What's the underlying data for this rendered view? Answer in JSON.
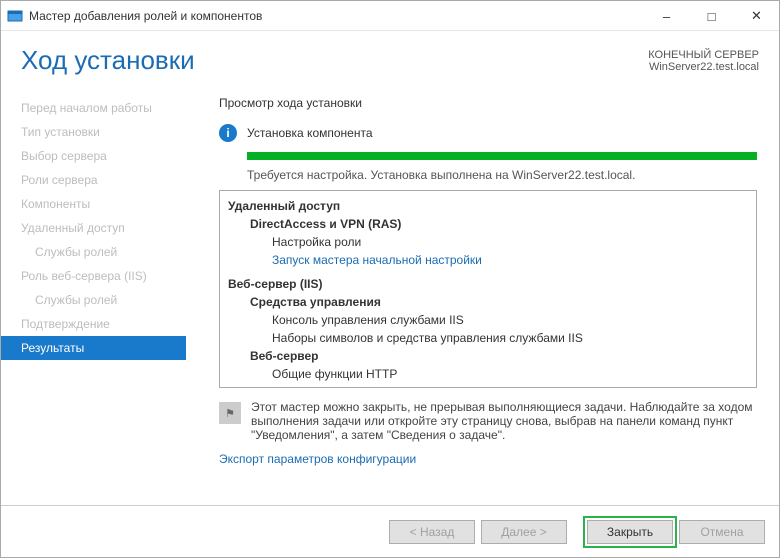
{
  "window": {
    "title": "Мастер добавления ролей и компонентов"
  },
  "header": {
    "title": "Ход установки",
    "dest_label": "КОНЕЧНЫЙ СЕРВЕР",
    "dest_server": "WinServer22.test.local"
  },
  "sidebar": {
    "steps": [
      "Перед началом работы",
      "Тип установки",
      "Выбор сервера",
      "Роли сервера",
      "Компоненты",
      "Удаленный доступ",
      "Службы ролей",
      "Роль веб-сервера (IIS)",
      "Службы ролей",
      "Подтверждение",
      "Результаты"
    ]
  },
  "main": {
    "section_title": "Просмотр хода установки",
    "status_text": "Установка компонента",
    "requires_text": "Требуется настройка. Установка выполнена на WinServer22.test.local.",
    "results": {
      "remote_access": "Удаленный доступ",
      "direct_vpn": "DirectAccess и VPN (RAS)",
      "config_role": "Настройка роли",
      "start_wizard": "Запуск мастера начальной настройки",
      "web_server": "Веб-сервер (IIS)",
      "mgmt_tools": "Средства управления",
      "iis_console": "Консоль управления службами IIS",
      "iis_scripts": "Наборы символов и средства управления службами IIS",
      "web_server2": "Веб-сервер",
      "http_common": "Общие функции HTTP"
    },
    "note_text": "Этот мастер можно закрыть, не прерывая выполняющиеся задачи. Наблюдайте за ходом выполнения задачи или откройте эту страницу снова, выбрав на панели команд пункт \"Уведомления\", а затем \"Сведения о задаче\".",
    "export_link": "Экспорт параметров конфигурации"
  },
  "footer": {
    "back": "< Назад",
    "next": "Далее >",
    "close": "Закрыть",
    "cancel": "Отмена"
  }
}
